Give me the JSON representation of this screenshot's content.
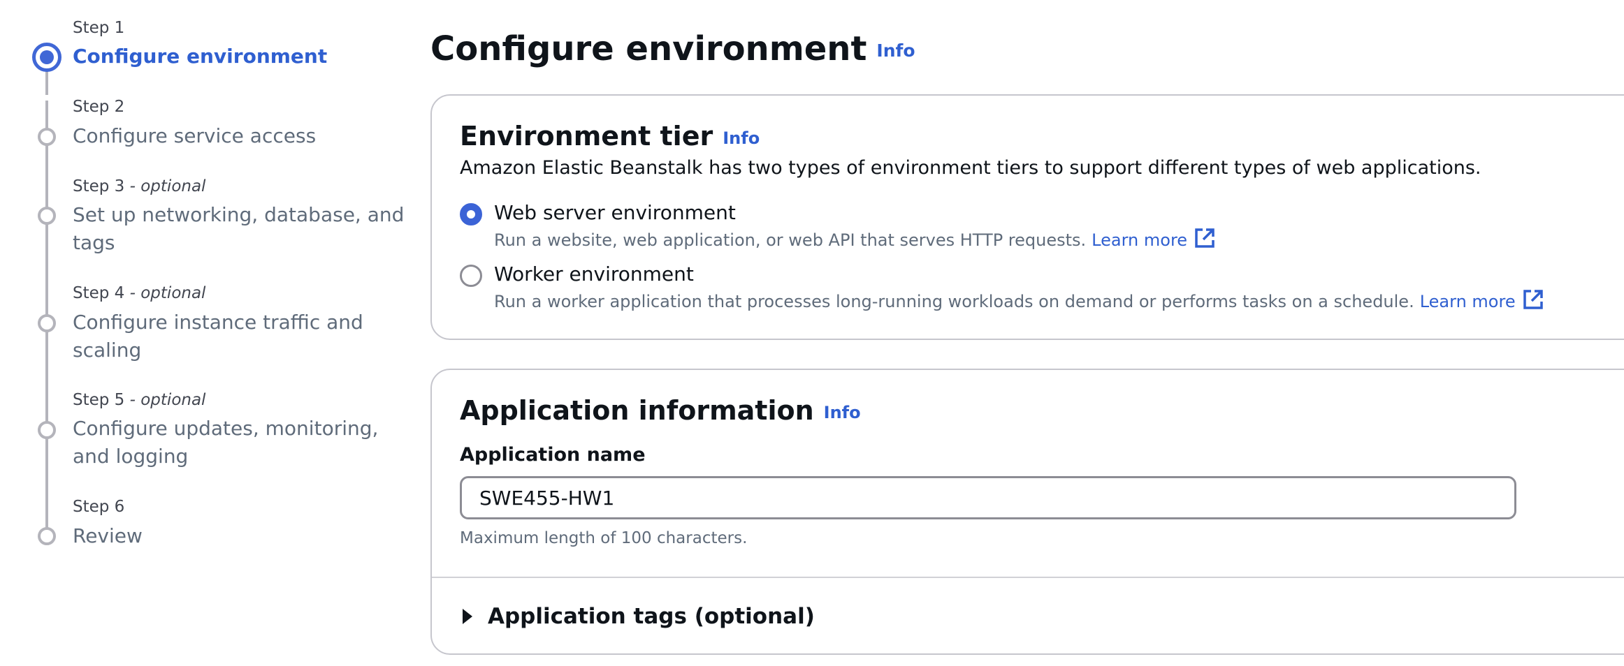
{
  "wizard_steps": [
    {
      "kicker": "Step 1",
      "optional": "",
      "title": "Configure environment",
      "state": "active"
    },
    {
      "kicker": "Step 2",
      "optional": "",
      "title": "Configure service access",
      "state": "inactive"
    },
    {
      "kicker": "Step 3",
      "optional": " - optional",
      "title": "Set up networking, database, and tags",
      "state": "inactive"
    },
    {
      "kicker": "Step 4",
      "optional": " - optional",
      "title": "Configure instance traffic and scaling",
      "state": "inactive"
    },
    {
      "kicker": "Step 5",
      "optional": " - optional",
      "title": "Configure updates, monitoring, and logging",
      "state": "inactive"
    },
    {
      "kicker": "Step 6",
      "optional": "",
      "title": "Review",
      "state": "inactive"
    }
  ],
  "page": {
    "title": "Configure environment",
    "info": "Info"
  },
  "environment_tier": {
    "title": "Environment tier",
    "info": "Info",
    "description": "Amazon Elastic Beanstalk has two types of environment tiers to support different types of web applications.",
    "options": [
      {
        "label": "Web server environment",
        "description": "Run a website, web application, or web API that serves HTTP requests.",
        "link": "Learn more",
        "selected": true
      },
      {
        "label": "Worker environment",
        "description": "Run a worker application that processes long-running workloads on demand or performs tasks on a schedule.",
        "link": "Learn more",
        "selected": false
      }
    ]
  },
  "application_information": {
    "title": "Application information",
    "info": "Info",
    "name_label": "Application name",
    "name_value": "SWE455-HW1",
    "name_constraint": "Maximum length of 100 characters.",
    "tags_label": "Application tags (optional)"
  },
  "colors": {
    "accent": "#2f5fd0",
    "radio_selected": "#3b63d6",
    "muted_text": "#5f6b7a",
    "border": "#c6c6cd"
  },
  "icons": [
    "external-link-icon",
    "caret-right-icon"
  ]
}
